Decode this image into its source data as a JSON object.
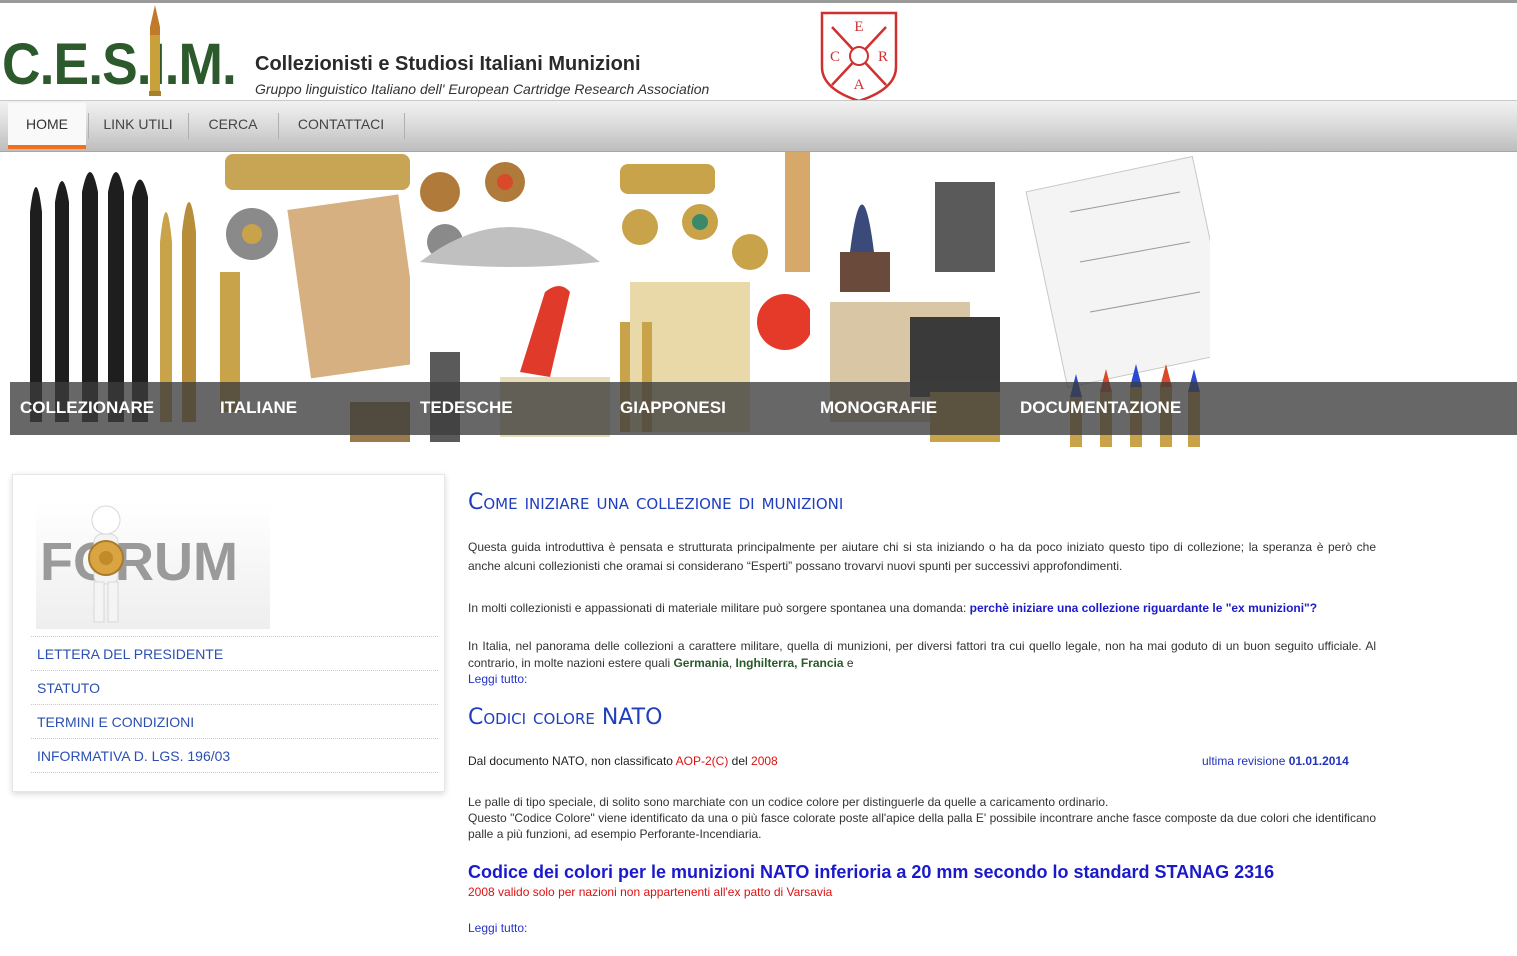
{
  "header": {
    "logo_text": "C.E.S.I.M.",
    "title": "Collezionisti e Studiosi Italiani Munizioni",
    "subtitle": "Gruppo linguistico Italiano dell' European Cartridge Research Association",
    "era_letters": [
      "E",
      "C",
      "R",
      "A"
    ]
  },
  "nav": {
    "items": [
      {
        "label": "HOME",
        "active": true
      },
      {
        "label": "LINK UTILI",
        "active": false
      },
      {
        "label": "CERCA",
        "active": false
      },
      {
        "label": "CONTATTACI",
        "active": false
      }
    ]
  },
  "banner": {
    "captions": [
      "COLLEZIONARE",
      "ITALIANE",
      "TEDESCHE",
      "GIAPPONESI",
      "MONOGRAFIE",
      "DOCUMENTAZIONE"
    ]
  },
  "sidebar": {
    "forum_label": "FORUM",
    "links": [
      "LETTERA DEL PRESIDENTE",
      "STATUTO",
      "TERMINI E CONDIZIONI",
      "INFORMATIVA D. LGS. 196/03"
    ]
  },
  "article1": {
    "title": "Come iniziare una collezione di munizioni",
    "intro": "Questa guida introduttiva è pensata e strutturata principalmente per aiutare chi si sta iniziando o ha da poco iniziato questo tipo di collezione; la speranza è però che anche alcuni collezionisti che oramai si considerano “Esperti” possano trovarvi nuovi spunti per successivi approfondimenti.",
    "q_lead": "In molti collezionisti e appassionati di materiale militare può sorgere spontanea una domanda: ",
    "q_text": "perchè iniziare una collezione riguardante le \"ex munizioni\"?",
    "body_lead": "In Italia, nel panorama delle collezioni a carattere militare, quella di munizioni, per diversi fattori tra cui quello legale, non ha mai goduto di un buon seguito ufficiale. Al contrario, in molte nazioni estere quali ",
    "country1": "Germania",
    "comma": ", ",
    "country2": "Inghilterra, Francia",
    "tail": " e",
    "read_more": "Leggi tutto:"
  },
  "article2": {
    "title": "Codici colore NATO",
    "doc_lead": "Dal documento NATO, non classificato ",
    "doc_code": "AOP-2(C)",
    "doc_mid": " del ",
    "doc_year": "2008",
    "rev_label": "ultima revisione ",
    "rev_date": "01.01.2014",
    "body_line1": "Le palle di tipo speciale, di solito sono marchiate con un codice colore per distinguerle da quelle a caricamento ordinario.",
    "body_line2": "Questo \"Codice Colore\" viene identificato da una o più fasce colorate poste all'apice della palla E' possibile incontrare anche fasce composte da due colori che identificano palle  a più funzioni, ad esempio Perforante-Incendiaria.",
    "subtitle": "Codice dei colori per le munizioni NATO inferioria a 20 mm secondo lo standard STANAG 2316",
    "note": "2008 valido solo per nazioni non appartenenti all'ex patto di Varsavia",
    "read_more": "Leggi tutto:"
  },
  "colors": {
    "logo_green": "#2c5a2c",
    "nav_active_underline": "#f07020",
    "heading_blue": "#1f3fbf",
    "link_blue": "#2b4fb2",
    "alert_red": "#dd1111"
  }
}
